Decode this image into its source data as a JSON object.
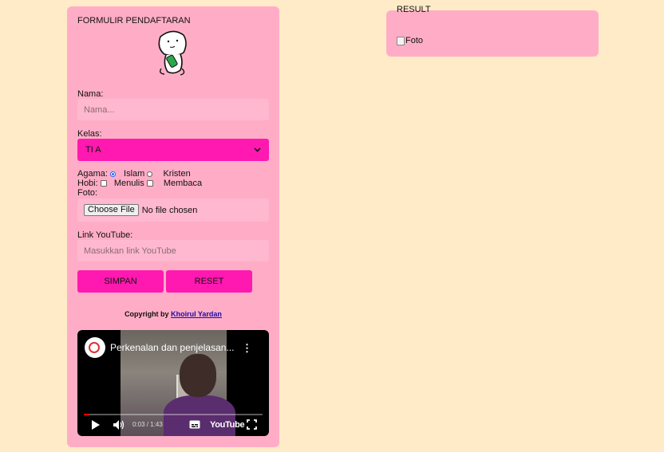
{
  "form": {
    "title": "FORMULIR PENDAFTARAN",
    "nama": {
      "label": "Nama:",
      "placeholder": "Nama..."
    },
    "kelas": {
      "label": "Kelas:",
      "selected": "TI A"
    },
    "agama": {
      "label": "Agama:",
      "options": [
        "Islam",
        "Kristen"
      ],
      "selected": "Islam"
    },
    "hobi": {
      "label": "Hobi:",
      "options": [
        "Menulis",
        "Membaca"
      ]
    },
    "foto": {
      "label": "Foto:",
      "button": "Choose File",
      "status": "No file chosen"
    },
    "youtube": {
      "label": "Link YouTube:",
      "placeholder": "Masukkan link YouTube"
    },
    "buttons": {
      "save": "SIMPAN",
      "reset": "RESET"
    },
    "copyright": {
      "prefix": "Copyright by",
      "author": "Khoirul Yardan"
    }
  },
  "video": {
    "title": "Perkenalan dan penjelasan...",
    "time": "0:03 / 1:43",
    "progress": 0.03,
    "brand": "YouTube"
  },
  "result": {
    "title": "RESULT",
    "image_alt": "Foto"
  },
  "colors": {
    "background": "#ffebc8",
    "card": "#ffadc7",
    "accent": "#ff19b0"
  }
}
